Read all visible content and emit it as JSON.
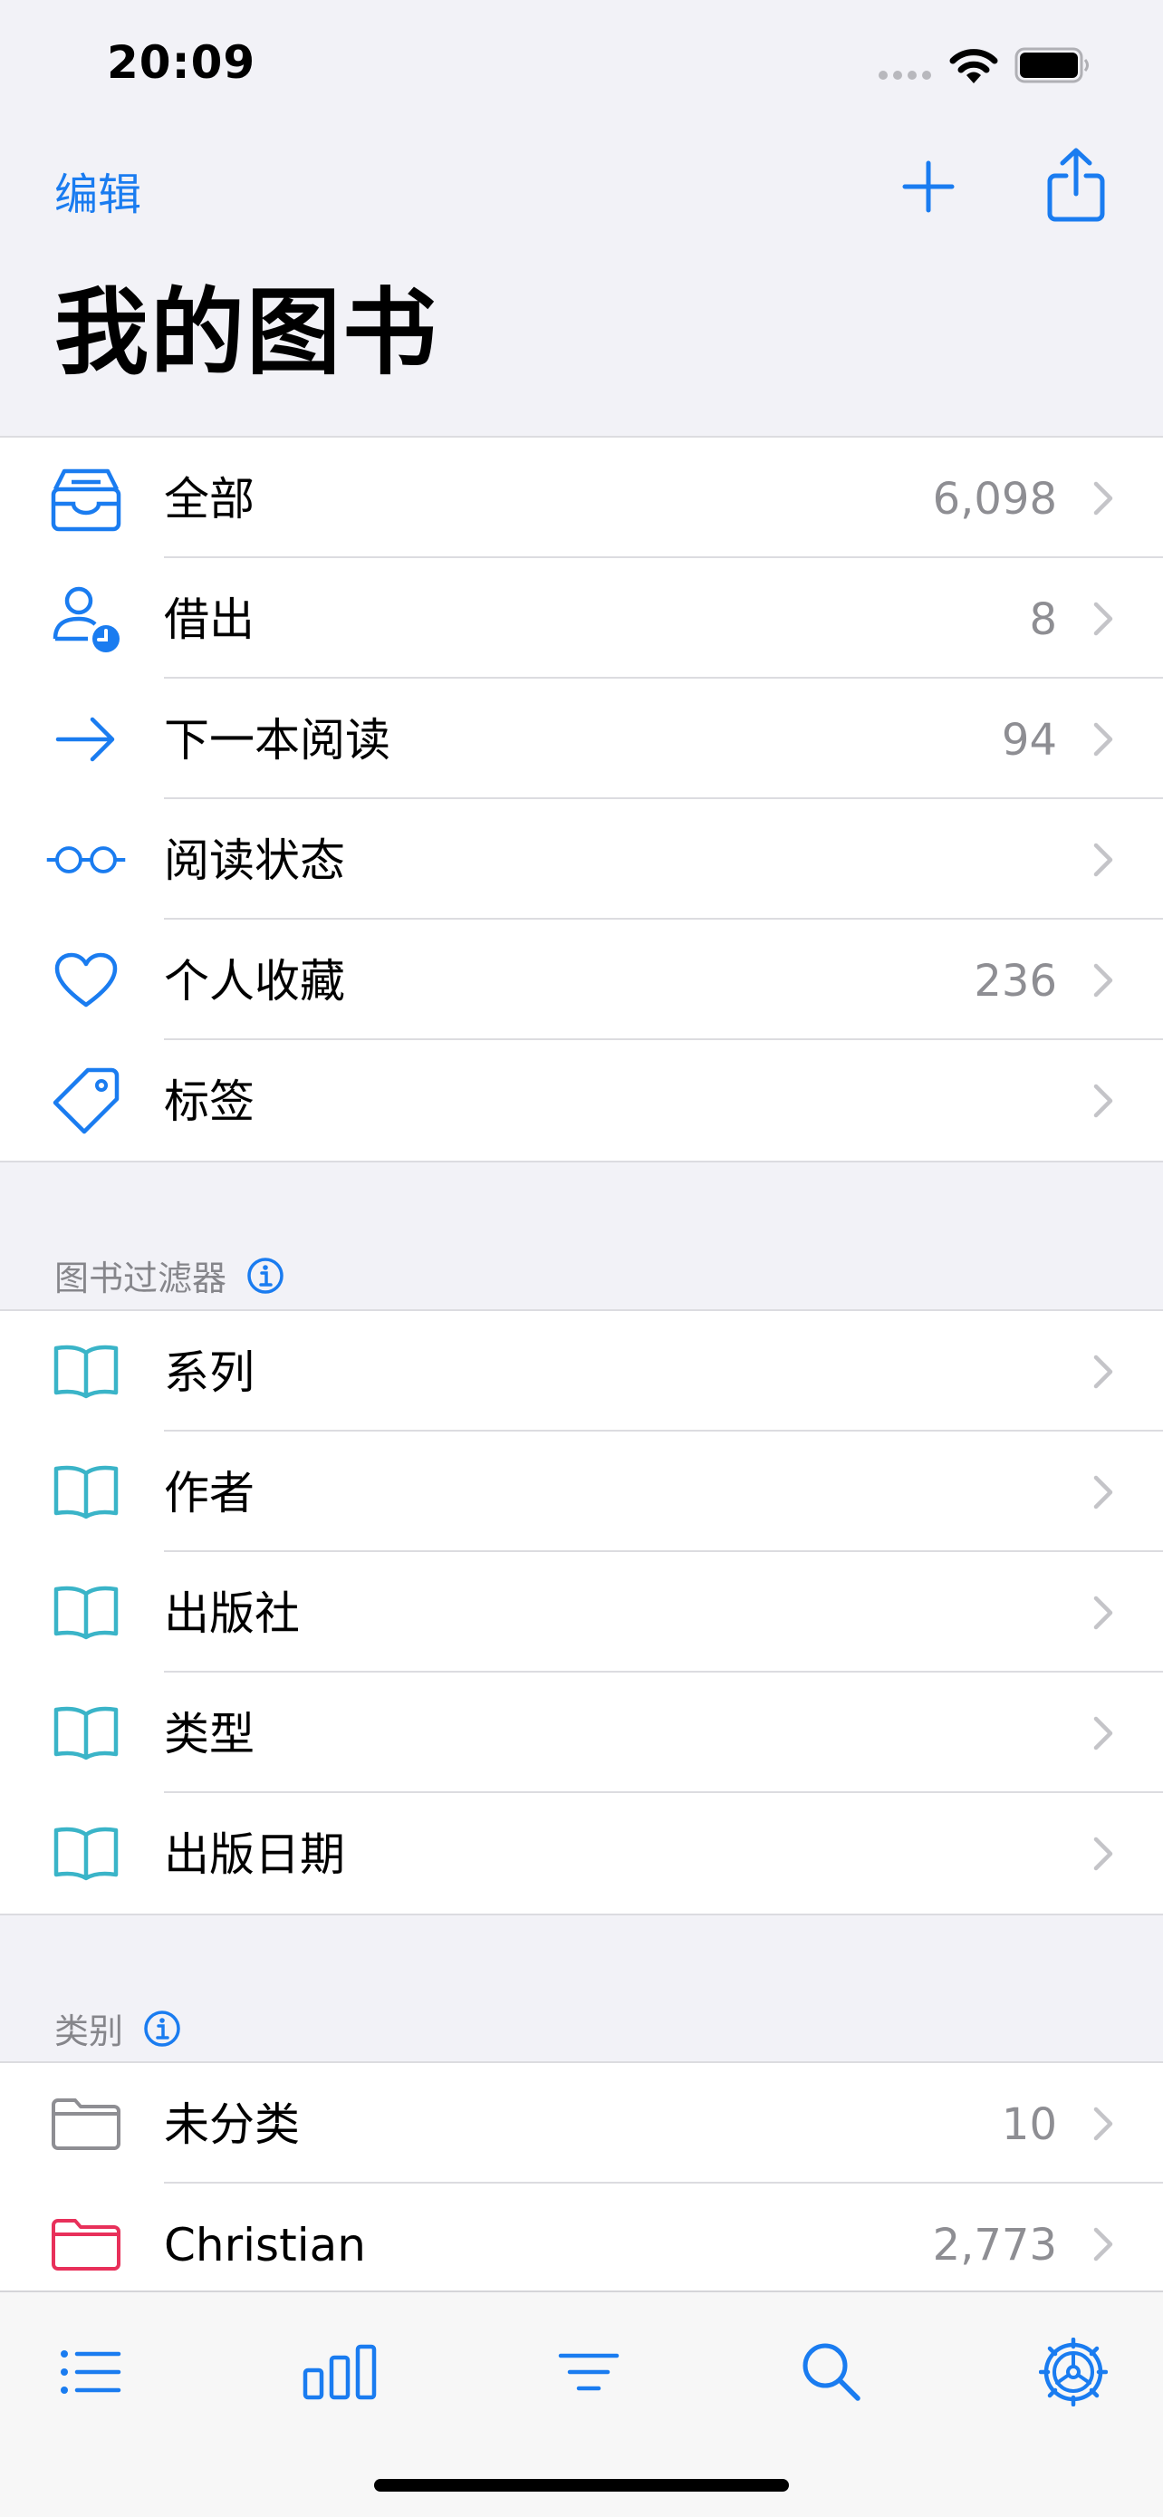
{
  "status": {
    "time": "20:09"
  },
  "nav": {
    "edit_label": "编辑",
    "title": "我的图书"
  },
  "colors": {
    "accent": "#1a7cf0",
    "book_icon": "#3ab4c8",
    "folder_gray": "#8e8e93",
    "folder_red": "#e8305a"
  },
  "main_list": [
    {
      "label": "全部",
      "count": "6,098",
      "icon": "tray-icon"
    },
    {
      "label": "借出",
      "count": "8",
      "icon": "person-clock-icon"
    },
    {
      "label": "下一本阅读",
      "count": "94",
      "icon": "arrow-right-icon"
    },
    {
      "label": "阅读状态",
      "count": "",
      "icon": "glasses-icon"
    },
    {
      "label": "个人收藏",
      "count": "236",
      "icon": "heart-icon"
    },
    {
      "label": "标签",
      "count": "",
      "icon": "tag-icon"
    }
  ],
  "filters_header": "图书过滤器",
  "filters": [
    {
      "label": "系列",
      "icon": "book-icon"
    },
    {
      "label": "作者",
      "icon": "book-icon"
    },
    {
      "label": "出版社",
      "icon": "book-icon"
    },
    {
      "label": "类型",
      "icon": "book-icon"
    },
    {
      "label": "出版日期",
      "icon": "book-icon"
    }
  ],
  "categories_header": "类别",
  "categories": [
    {
      "label": "未分类",
      "count": "10",
      "icon": "folder-icon"
    },
    {
      "label": "Christian",
      "count": "2,773",
      "icon": "folder-icon"
    }
  ],
  "tabs": [
    {
      "name": "list-icon"
    },
    {
      "name": "chart-icon"
    },
    {
      "name": "filter-icon"
    },
    {
      "name": "search-icon"
    },
    {
      "name": "settings-icon"
    }
  ]
}
